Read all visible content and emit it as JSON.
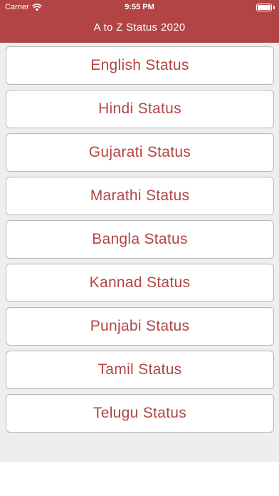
{
  "status_bar": {
    "carrier": "Carrier",
    "time": "9:55 PM"
  },
  "header": {
    "title": "A to Z Status 2020",
    "color": "#b24544"
  },
  "list": {
    "items": [
      {
        "label": "English Status"
      },
      {
        "label": "Hindi Status"
      },
      {
        "label": "Gujarati Status"
      },
      {
        "label": "Marathi Status"
      },
      {
        "label": "Bangla Status"
      },
      {
        "label": "Kannad Status"
      },
      {
        "label": "Punjabi Status"
      },
      {
        "label": "Tamil Status"
      },
      {
        "label": "Telugu Status"
      }
    ]
  }
}
